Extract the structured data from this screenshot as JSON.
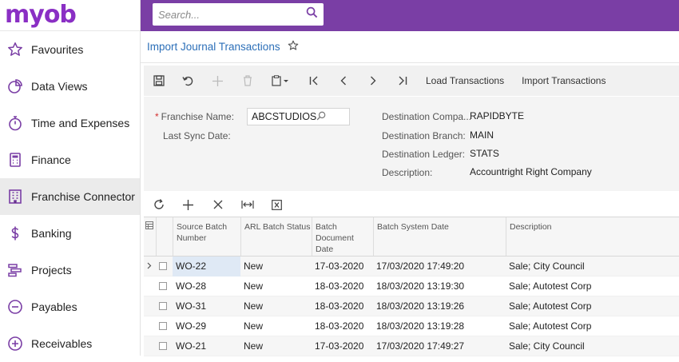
{
  "app": {
    "logo": "myob",
    "brand_color": "#8a2fc4",
    "topbar_color": "#7a3ea5"
  },
  "search": {
    "placeholder": "Search..."
  },
  "sidebar": {
    "items": [
      {
        "label": "Favourites",
        "icon": "star-icon"
      },
      {
        "label": "Data Views",
        "icon": "pie-chart-icon"
      },
      {
        "label": "Time and Expenses",
        "icon": "stopwatch-icon"
      },
      {
        "label": "Finance",
        "icon": "calculator-icon"
      },
      {
        "label": "Franchise Connector",
        "icon": "building-icon",
        "active": true
      },
      {
        "label": "Banking",
        "icon": "dollar-icon"
      },
      {
        "label": "Projects",
        "icon": "projects-icon"
      },
      {
        "label": "Payables",
        "icon": "minus-circle-icon"
      },
      {
        "label": "Receivables",
        "icon": "plus-circle-icon"
      }
    ]
  },
  "page": {
    "title": "Import Journal Transactions"
  },
  "toolbar": {
    "load_label": "Load Transactions",
    "import_label": "Import Transactions"
  },
  "form": {
    "franchise_name_label": "Franchise Name:",
    "franchise_name_value": "ABCSTUDIOS",
    "last_sync_label": "Last Sync Date:",
    "dest_company_label": "Destination Compa...",
    "dest_company_value": "RAPIDBYTE",
    "dest_branch_label": "Destination Branch:",
    "dest_branch_value": "MAIN",
    "dest_ledger_label": "Destination Ledger:",
    "dest_ledger_value": "STATS",
    "description_label": "Description:",
    "description_value": "Accountright Right Company"
  },
  "grid": {
    "headers": [
      "Source Batch Number",
      "ARL Batch Status",
      "Batch Document Date",
      "Batch System Date",
      "Description"
    ],
    "rows": [
      {
        "batch": "WO-22",
        "status": "New",
        "doc_date": "17-03-2020",
        "sys_date": "17/03/2020 17:49:20",
        "desc": "Sale; City Council"
      },
      {
        "batch": "WO-28",
        "status": "New",
        "doc_date": "18-03-2020",
        "sys_date": "18/03/2020 13:19:30",
        "desc": "Sale; Autotest Corp"
      },
      {
        "batch": "WO-31",
        "status": "New",
        "doc_date": "18-03-2020",
        "sys_date": "18/03/2020 13:19:26",
        "desc": "Sale; Autotest Corp"
      },
      {
        "batch": "WO-29",
        "status": "New",
        "doc_date": "18-03-2020",
        "sys_date": "18/03/2020 13:19:28",
        "desc": "Sale; Autotest Corp"
      },
      {
        "batch": "WO-21",
        "status": "New",
        "doc_date": "17-03-2020",
        "sys_date": "17/03/2020 17:49:27",
        "desc": "Sale; City Council"
      }
    ]
  }
}
